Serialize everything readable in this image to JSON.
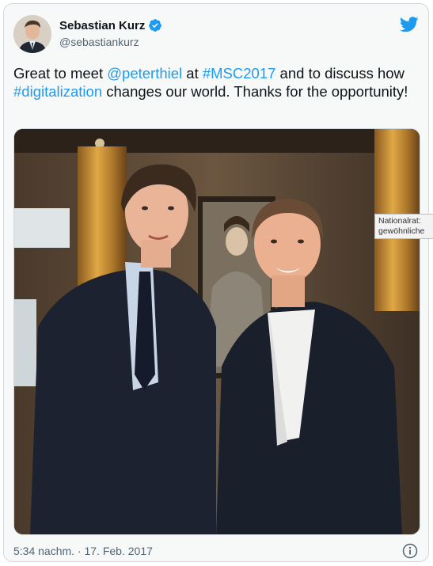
{
  "author": {
    "display_name": "Sebastian Kurz",
    "handle": "@sebastiankurz",
    "verified_icon": "verified-badge-icon",
    "avatar": "avatar-photo"
  },
  "brand": {
    "logo": "twitter-bird-icon",
    "accent_color": "#1d9bf0"
  },
  "tweet": {
    "segments": [
      {
        "text": "Great to meet ",
        "type": "text"
      },
      {
        "text": "@peterthiel",
        "type": "mention"
      },
      {
        "text": " at ",
        "type": "text"
      },
      {
        "text": "#MSC2017",
        "type": "hashtag"
      },
      {
        "text": " and to discuss how ",
        "type": "text"
      },
      {
        "text": "#digitalization",
        "type": "hashtag"
      },
      {
        "text": " changes our world. Thanks for the opportunity!",
        "type": "text"
      }
    ],
    "timestamp": "5:34 nachm. · 17. Feb. 2017",
    "info_icon": "info-icon"
  },
  "tooltip": {
    "line1": "Nationalrat:",
    "line2": "gewöhnliche"
  }
}
